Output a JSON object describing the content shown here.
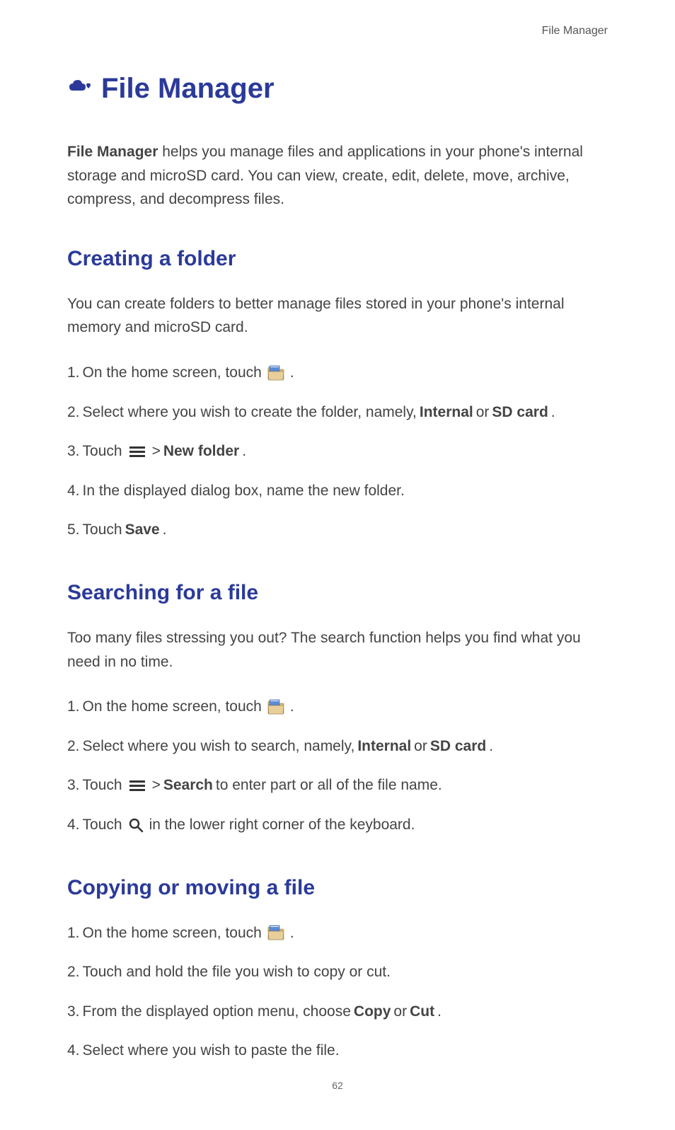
{
  "header": {
    "label": "File Manager"
  },
  "title": "File Manager",
  "intro": {
    "bold_lead": "File Manager",
    "text": " helps you manage files and applications in your phone's internal storage and microSD card. You can view, create, edit, delete, move, archive, compress, and decompress files."
  },
  "sections": [
    {
      "heading": "Creating a folder",
      "intro": "You can create folders to better manage files stored in your phone's internal memory and microSD card.",
      "steps": [
        {
          "num": "1.",
          "parts": [
            {
              "type": "text",
              "value": "On the home screen, touch "
            },
            {
              "type": "icon",
              "name": "folder"
            },
            {
              "type": "text",
              "value": " ."
            }
          ]
        },
        {
          "num": "2.",
          "parts": [
            {
              "type": "text",
              "value": "Select where you wish to create the folder, namely, "
            },
            {
              "type": "bold",
              "value": "Internal"
            },
            {
              "type": "text",
              "value": " or "
            },
            {
              "type": "bold",
              "value": "SD card"
            },
            {
              "type": "text",
              "value": "."
            }
          ]
        },
        {
          "num": "3.",
          "parts": [
            {
              "type": "text",
              "value": "Touch "
            },
            {
              "type": "icon",
              "name": "menu"
            },
            {
              "type": "text",
              "value": "  > "
            },
            {
              "type": "bold",
              "value": "New folder"
            },
            {
              "type": "text",
              "value": "."
            }
          ]
        },
        {
          "num": "4.",
          "parts": [
            {
              "type": "text",
              "value": "In the displayed dialog box, name the new folder."
            }
          ]
        },
        {
          "num": "5.",
          "parts": [
            {
              "type": "text",
              "value": "Touch "
            },
            {
              "type": "bold",
              "value": "Save"
            },
            {
              "type": "text",
              "value": "."
            }
          ]
        }
      ]
    },
    {
      "heading": "Searching for a file",
      "intro": "Too many files stressing you out? The search function helps you find what you need in no time.",
      "steps": [
        {
          "num": "1.",
          "parts": [
            {
              "type": "text",
              "value": "On the home screen, touch "
            },
            {
              "type": "icon",
              "name": "folder"
            },
            {
              "type": "text",
              "value": " ."
            }
          ]
        },
        {
          "num": "2.",
          "parts": [
            {
              "type": "text",
              "value": "Select where you wish to search, namely, "
            },
            {
              "type": "bold",
              "value": "Internal"
            },
            {
              "type": "text",
              "value": " or "
            },
            {
              "type": "bold",
              "value": "SD card"
            },
            {
              "type": "text",
              "value": "."
            }
          ]
        },
        {
          "num": "3.",
          "parts": [
            {
              "type": "text",
              "value": "Touch "
            },
            {
              "type": "icon",
              "name": "menu"
            },
            {
              "type": "text",
              "value": "  > "
            },
            {
              "type": "bold",
              "value": "Search"
            },
            {
              "type": "text",
              "value": " to enter part or all of the file name."
            }
          ]
        },
        {
          "num": "4.",
          "parts": [
            {
              "type": "text",
              "value": "Touch "
            },
            {
              "type": "icon",
              "name": "search"
            },
            {
              "type": "text",
              "value": "  in the lower right corner of the keyboard."
            }
          ]
        }
      ]
    },
    {
      "heading": "Copying or moving a file",
      "intro": "",
      "steps": [
        {
          "num": "1.",
          "parts": [
            {
              "type": "text",
              "value": "On the home screen, touch "
            },
            {
              "type": "icon",
              "name": "folder"
            },
            {
              "type": "text",
              "value": " ."
            }
          ]
        },
        {
          "num": "2.",
          "parts": [
            {
              "type": "text",
              "value": "Touch and hold the file you wish to copy or cut."
            }
          ]
        },
        {
          "num": "3.",
          "parts": [
            {
              "type": "text",
              "value": "From the displayed option menu, choose "
            },
            {
              "type": "bold",
              "value": "Copy"
            },
            {
              "type": "text",
              "value": " or "
            },
            {
              "type": "bold",
              "value": "Cut"
            },
            {
              "type": "text",
              "value": "."
            }
          ]
        },
        {
          "num": "4.",
          "parts": [
            {
              "type": "text",
              "value": "Select where you wish to paste the file."
            }
          ]
        }
      ]
    }
  ],
  "page_number": "62"
}
